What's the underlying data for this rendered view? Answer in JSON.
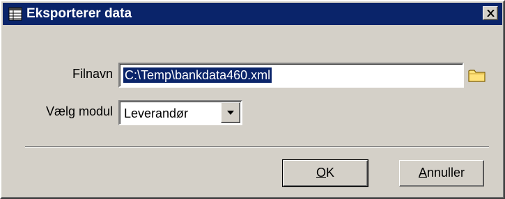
{
  "dialog": {
    "title": "Eksporterer data",
    "title_icon": "spreadsheet-icon",
    "close_icon": "close-icon"
  },
  "form": {
    "file_label": "Filnavn",
    "file_value": "C:\\Temp\\bankdata460.xml",
    "browse_icon": "folder-icon",
    "module_label": "Vælg modul",
    "module_value": "Leverandør",
    "dropdown_icon": "chevron-down-icon"
  },
  "buttons": {
    "ok_mnemonic": "O",
    "ok_rest": "K",
    "cancel_mnemonic": "A",
    "cancel_rest": "nnuller"
  },
  "colors": {
    "titlebar": "#0a246a",
    "face": "#d4d0c8",
    "selection": "#0a246a",
    "folder": "#ffe27a"
  }
}
